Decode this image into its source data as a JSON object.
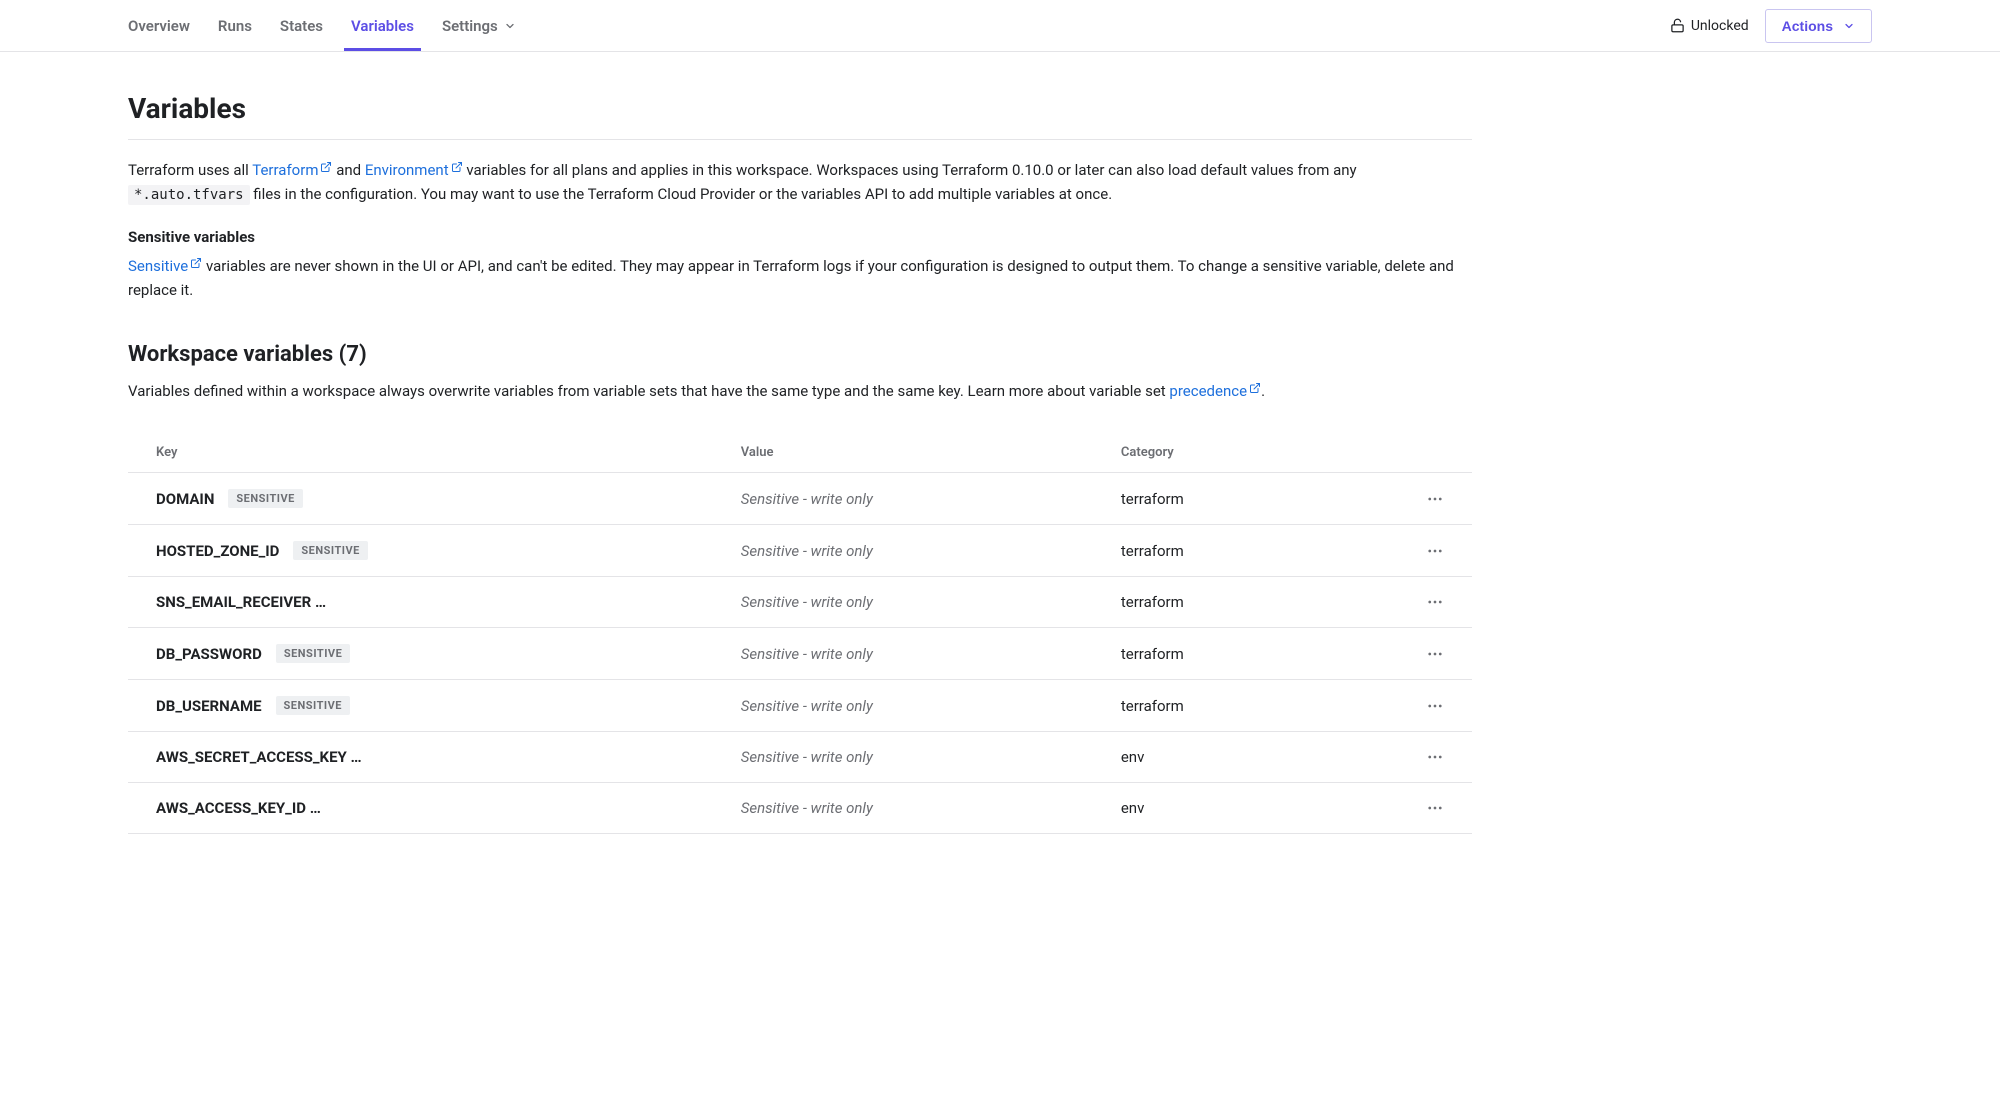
{
  "topbar": {
    "tabs": [
      {
        "label": "Overview"
      },
      {
        "label": "Runs"
      },
      {
        "label": "States"
      },
      {
        "label": "Variables"
      },
      {
        "label": "Settings"
      }
    ],
    "unlocked_label": "Unlocked",
    "actions_label": "Actions"
  },
  "page": {
    "title": "Variables",
    "intro_prefix": "Terraform uses all ",
    "intro_link1": "Terraform",
    "intro_mid1": " and ",
    "intro_link2": "Environment",
    "intro_mid2": " variables for all plans and applies in this workspace. Workspaces using Terraform 0.10.0 or later can also load default values from any ",
    "intro_code": "*.auto.tfvars",
    "intro_suffix": " files in the configuration. You may want to use the Terraform Cloud Provider or the variables API to add multiple variables at once.",
    "sensitive_heading": "Sensitive variables",
    "sensitive_link": "Sensitive",
    "sensitive_text": " variables are never shown in the UI or API, and can't be edited. They may appear in Terraform logs if your configuration is designed to output them. To change a sensitive variable, delete and replace it.",
    "ws_title": "Workspace variables (7)",
    "ws_desc_prefix": "Variables defined within a workspace always overwrite variables from variable sets that have the same type and the same key. Learn more about variable set ",
    "ws_desc_link": "precedence",
    "ws_desc_suffix": "."
  },
  "table": {
    "headers": {
      "key": "Key",
      "value": "Value",
      "category": "Category"
    },
    "sensitive_badge": "SENSITIVE",
    "sensitive_value": "Sensitive - write only",
    "rows": [
      {
        "key": "DOMAIN",
        "show_badge": true,
        "category": "terraform"
      },
      {
        "key": "HOSTED_ZONE_ID",
        "show_badge": true,
        "category": "terraform"
      },
      {
        "key": "SNS_EMAIL_RECEIVER …",
        "show_badge": false,
        "category": "terraform"
      },
      {
        "key": "DB_PASSWORD",
        "show_badge": true,
        "category": "terraform"
      },
      {
        "key": "DB_USERNAME",
        "show_badge": true,
        "category": "terraform"
      },
      {
        "key": "AWS_SECRET_ACCESS_KEY …",
        "show_badge": false,
        "category": "env"
      },
      {
        "key": "AWS_ACCESS_KEY_ID …",
        "show_badge": false,
        "category": "env"
      }
    ]
  }
}
